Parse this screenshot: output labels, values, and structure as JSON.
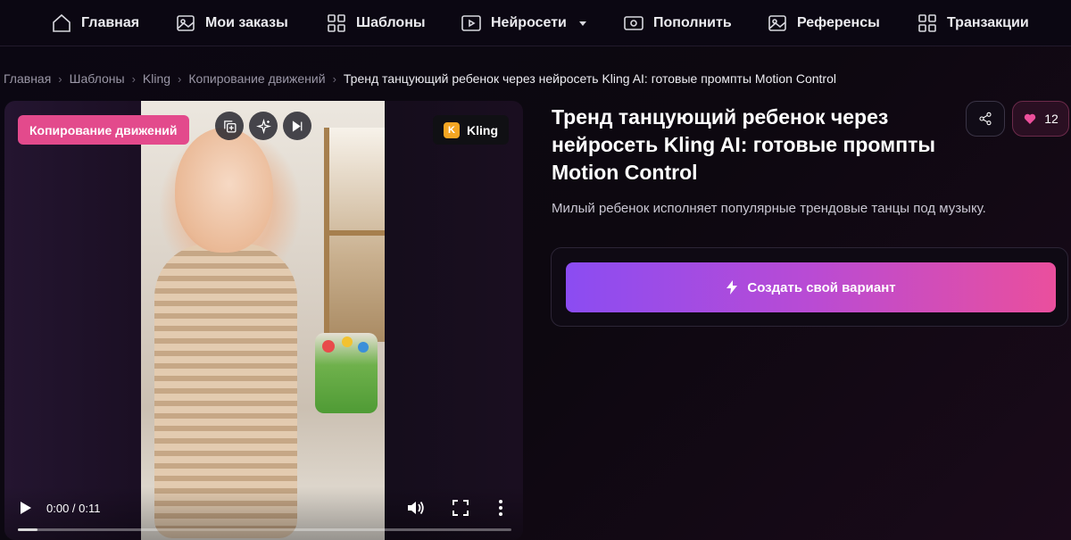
{
  "nav": {
    "items": [
      {
        "label": "Главная",
        "icon": "home-icon"
      },
      {
        "label": "Мои заказы",
        "icon": "image-icon"
      },
      {
        "label": "Шаблоны",
        "icon": "grid-icon"
      },
      {
        "label": "Нейросети",
        "icon": "video-icon",
        "has_dropdown": true
      },
      {
        "label": "Пополнить",
        "icon": "money-icon"
      },
      {
        "label": "Референсы",
        "icon": "image-icon"
      },
      {
        "label": "Транзакции",
        "icon": "grid-icon"
      }
    ]
  },
  "breadcrumb": {
    "items": [
      "Главная",
      "Шаблоны",
      "Kling",
      "Копирование движений"
    ],
    "current": "Тренд танцующий ребенок через нейросеть Kling AI: готовые промпты Motion Control"
  },
  "video": {
    "category_badge": "Копирование движений",
    "model_badge": {
      "letter": "K",
      "label": "Kling",
      "color": "#f5a623"
    },
    "overlay_icons": [
      "duplicate-icon",
      "sparkles-icon",
      "skip-forward-icon"
    ],
    "time": "0:00 / 0:11",
    "progress": 0.04
  },
  "template": {
    "title": "Тренд танцующий ребенок через нейросеть Kling AI: готовые промпты Motion Control",
    "description": "Милый ребенок исполняет популярные трендовые танцы под музыку.",
    "likes": "12",
    "create_button": "Создать свой вариант"
  },
  "colors": {
    "accent_pink": "#e34a8c",
    "gradient_start": "#8b4cf2",
    "gradient_end": "#ea4f9d",
    "like_heart": "#ec4f9b"
  }
}
